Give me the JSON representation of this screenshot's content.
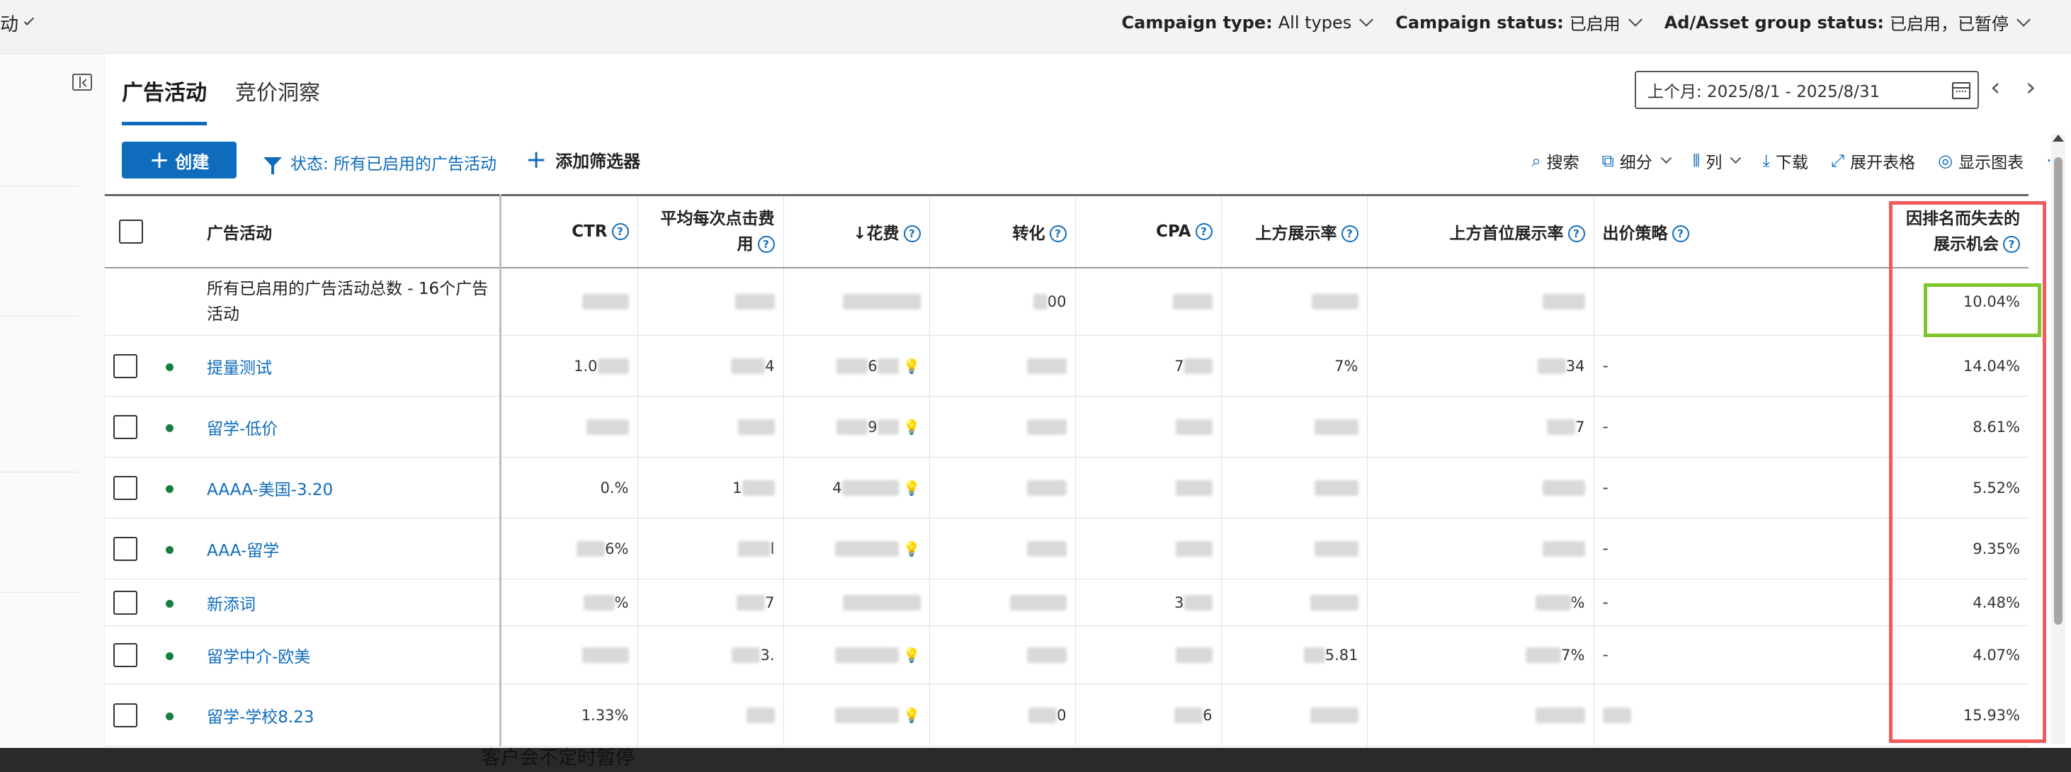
{
  "topbar": {
    "edge_text": "动",
    "filters": [
      {
        "label": "Campaign type:",
        "value": "All types"
      },
      {
        "label": "Campaign status:",
        "value": "已启用"
      },
      {
        "label": "Ad/Asset group status:",
        "value": "已启用，已暂停"
      }
    ]
  },
  "tabs": [
    {
      "label": "广告活动",
      "active": true
    },
    {
      "label": "竞价洞察",
      "active": false
    }
  ],
  "date_range": "上个月: 2025/8/1 - 2025/8/31",
  "toolbar": {
    "create_label": "创建",
    "status_filter": "状态: 所有已启用的广告活动",
    "add_filter": "添加筛选器",
    "tools": [
      {
        "label": "搜索",
        "icon": "search-icon"
      },
      {
        "label": "细分",
        "icon": "segment-icon"
      },
      {
        "label": "列",
        "icon": "columns-icon"
      },
      {
        "label": "下载",
        "icon": "download-icon"
      },
      {
        "label": "展开表格",
        "icon": "expand-icon"
      },
      {
        "label": "显示图表",
        "icon": "chart-icon"
      }
    ],
    "more": "···"
  },
  "table": {
    "headers": {
      "campaign": "广告活动",
      "ctr": "CTR",
      "avg_cpc_1": "平均每次点击费",
      "avg_cpc_2": "用",
      "cost": "↓花费",
      "conversions": "转化",
      "cpa": "CPA",
      "top_impr": "上方展示率",
      "abs_top_impr": "上方首位展示率",
      "bid_strategy": "出价策略",
      "lost_rank_1": "因排名而失去的",
      "lost_rank_2": "展示机会"
    },
    "total": {
      "label": "所有已启用的广告活动总数 - 16个广告活动",
      "conversions": "00",
      "lost_rank": "10.04%"
    },
    "rows": [
      {
        "name": "提量测试",
        "ctr": "1.0",
        "cpc": "4",
        "cost": "6",
        "conv": "",
        "cpa": "7",
        "top": "7%",
        "abs": "34",
        "bid": "-",
        "lost": "14.04%"
      },
      {
        "name": "留学-低价",
        "ctr": "",
        "cpc": "",
        "cost": "9",
        "conv": "",
        "cpa": "",
        "top": "",
        "abs": "7",
        "bid": "-",
        "lost": "8.61%"
      },
      {
        "name": "AAAA-美国-3.20",
        "ctr": "0.%",
        "cpc": "1",
        "cost": "4",
        "conv": "",
        "cpa": "",
        "top": "",
        "abs": "",
        "bid": "-",
        "lost": "5.52%"
      },
      {
        "name": "AAA-留学",
        "ctr": "6%",
        "cpc": "l",
        "cost": "",
        "conv": "",
        "cpa": "",
        "top": "",
        "abs": "",
        "bid": "-",
        "lost": "9.35%"
      },
      {
        "name": "新添词",
        "ctr": "%",
        "cpc": "7",
        "cost": "",
        "conv": "",
        "cpa": "3",
        "top": "",
        "abs": "%",
        "bid": "-",
        "lost": "4.48%"
      },
      {
        "name": "留学中介-欧美",
        "ctr": "",
        "cpc": "3.",
        "cost": "",
        "conv": "",
        "cpa": "",
        "top": "5.81",
        "abs": "7%",
        "bid": "-",
        "lost": "4.07%"
      },
      {
        "name": "留学-学校8.23",
        "ctr": "1.33%",
        "cpc": "",
        "cost": "",
        "conv": "0",
        "cpa": "6",
        "top": "",
        "abs": "",
        "bid": "",
        "lost": "15.93%"
      }
    ]
  },
  "bottom_caption": "客户会不定时暂停",
  "colors": {
    "accent": "#0f6cbd",
    "highlight_red": "#ef5a5a",
    "highlight_green": "#7ec62a",
    "status_green": "#15803d"
  }
}
